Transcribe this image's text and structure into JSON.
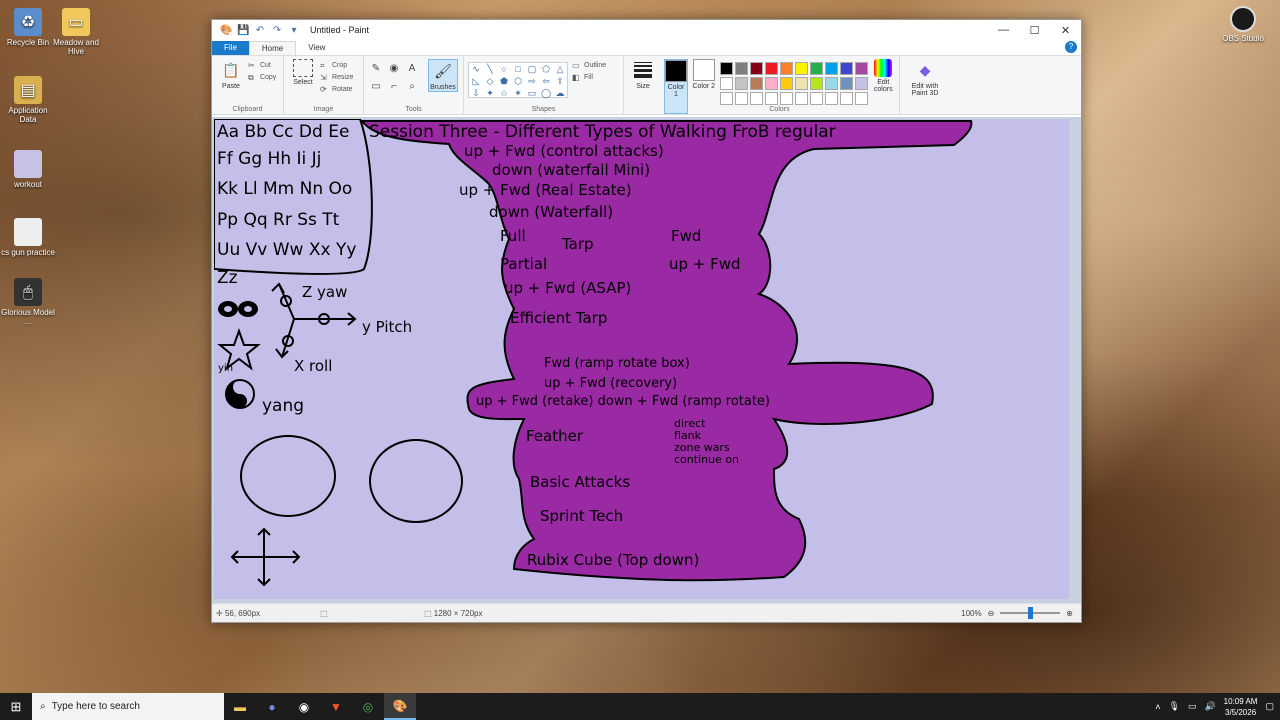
{
  "desktop": {
    "icons": [
      {
        "label": "Recycle Bin",
        "icon": "recycle-bin-icon"
      },
      {
        "label": "Meadow and Hive",
        "icon": "folder-icon"
      },
      {
        "label": "Application Data",
        "icon": "application-icon"
      },
      {
        "label": "workout",
        "icon": "image-file-icon"
      },
      {
        "label": "cs gun practice",
        "icon": "image-file-icon"
      },
      {
        "label": "Glorious Model ...",
        "icon": "mouse-icon"
      }
    ],
    "obs_label": "OBS Studio"
  },
  "paint": {
    "title": "Untitled - Paint",
    "tabs": {
      "file": "File",
      "home": "Home",
      "view": "View"
    },
    "ribbon": {
      "clipboard": {
        "paste": "Paste",
        "cut": "Cut",
        "copy": "Copy",
        "label": "Clipboard"
      },
      "image": {
        "select": "Select",
        "crop": "Crop",
        "resize": "Resize",
        "rotate": "Rotate",
        "label": "Image"
      },
      "tools": {
        "label": "Tools",
        "brushes": "Brushes"
      },
      "shapes": {
        "outline": "Outline",
        "fill": "Fill",
        "label": "Shapes"
      },
      "size": "Size",
      "color1": "Color 1",
      "color2": "Color 2",
      "colors_label": "Colors",
      "edit_colors": "Edit colors",
      "edit_paint3d": "Edit with Paint 3D",
      "palette": [
        "#000000",
        "#7f7f7f",
        "#880015",
        "#ed1c24",
        "#ff7f27",
        "#fff200",
        "#22b14c",
        "#00a2e8",
        "#3f48cc",
        "#a349a4",
        "#ffffff",
        "#c3c3c3",
        "#b97a57",
        "#ffaec9",
        "#ffc90e",
        "#efe4b0",
        "#b5e61d",
        "#99d9ea",
        "#7092be",
        "#c8bfe7"
      ]
    },
    "canvas_text": {
      "alphabet": [
        "Aa Bb Cc Dd Ee",
        "Ff Gg Hh Ii Jj",
        "Kk Ll Mm Nn Oo",
        "Pp Qq Rr Ss Tt",
        "Uu Vv Ww Xx Yy",
        "Zz"
      ],
      "axes": {
        "z": "Z yaw",
        "y": "y Pitch",
        "x": "X roll"
      },
      "yin": "yin",
      "yang": "yang",
      "title": "Session Three - Different Types of Walking FroB regular",
      "lines": [
        "up + Fwd (control attacks)",
        "down (waterfall Mini)",
        "up + Fwd (Real Estate)",
        "down (Waterfall)",
        "Tarp",
        "Fwd",
        "up + Fwd",
        "Full",
        "Partial",
        "up + Fwd (ASAP)",
        "Efficient Tarp",
        "Fwd (ramp rotate box)",
        "up + Fwd (recovery)",
        "up + Fwd (retake) down + Fwd (ramp rotate)",
        "Feather",
        "direct",
        "flank",
        "zone wars",
        "continue on",
        "Basic Attacks",
        "Sprint Tech",
        "Rubix Cube (Top down)"
      ]
    },
    "status": {
      "position": "56, 690px",
      "canvas_size": "1280 × 720px",
      "zoom": "100%"
    }
  },
  "taskbar": {
    "search_placeholder": "Type here to search",
    "time": "10:09 AM",
    "date": "3/5/2026"
  }
}
